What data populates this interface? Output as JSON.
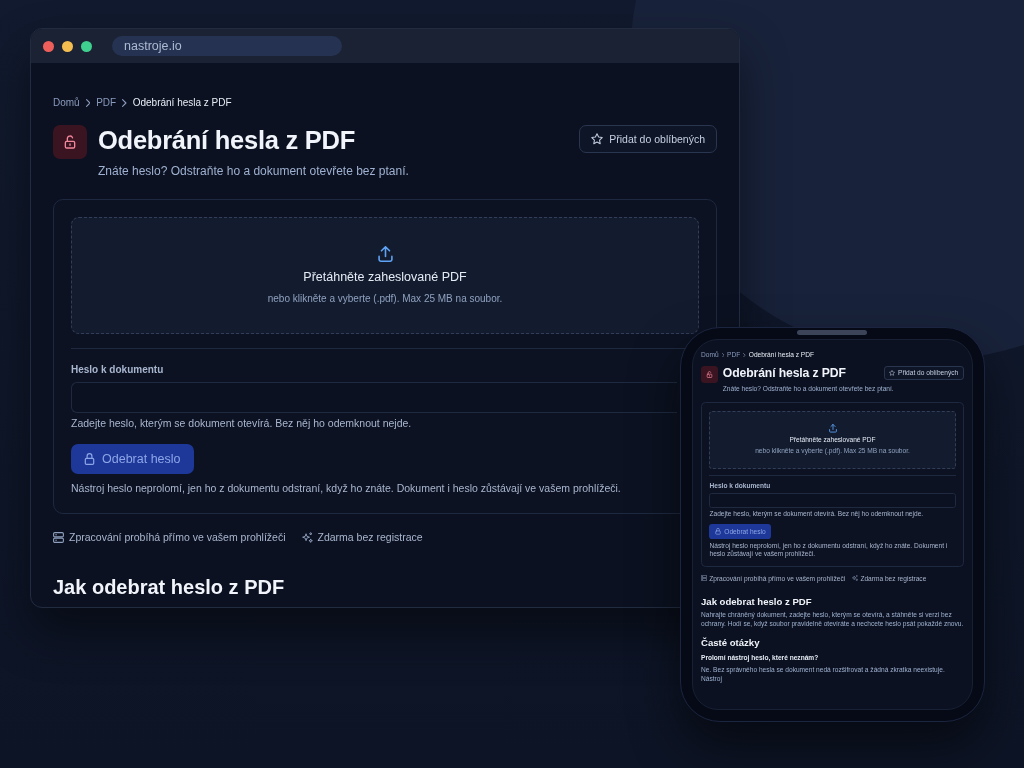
{
  "browser": {
    "address": "nastroje.io",
    "page": {
      "breadcrumb": [
        {
          "label": "Domů",
          "current": false
        },
        {
          "label": "PDF",
          "current": false
        },
        {
          "label": "Odebrání hesla z PDF",
          "current": true
        }
      ],
      "title": "Odebrání hesla z PDF",
      "subtitle": "Znáte heslo? Odstraňte ho a dokument otevřete bez ptaní.",
      "favorite_button": "Přidat do oblíbených",
      "dropzone": {
        "title": "Přetáhněte zaheslované PDF",
        "hint": "nebo klikněte a vyberte (.pdf). Max 25 MB na soubor."
      },
      "password": {
        "label": "Heslo k dokumentu",
        "help": "Zadejte heslo, kterým se dokument otevírá. Bez něj ho odemknout nejde."
      },
      "submit": {
        "label": "Odebrat heslo",
        "disabled": true
      },
      "note": "Nástroj heslo neprolomí, jen ho z dokumentu odstraní, když ho znáte. Dokument i heslo zůstávají ve vašem prohlížeči.",
      "features": [
        {
          "kind": "local",
          "label": "Zpracování probíhá přímo ve vašem prohlížeči"
        },
        {
          "kind": "free",
          "label": "Zdarma bez registrace"
        }
      ],
      "sections": [
        {
          "heading": "Jak odebrat heslo z PDF"
        }
      ]
    }
  },
  "phone": {
    "page": {
      "breadcrumb": [
        {
          "label": "Domů",
          "current": false
        },
        {
          "label": "PDF",
          "current": false
        },
        {
          "label": "Odebrání hesla z PDF",
          "current": true
        }
      ],
      "title": "Odebrání hesla z PDF",
      "subtitle": "Znáte heslo? Odstraňte ho a dokument otevřete bez ptaní.",
      "favorite_button": "Přidat do oblíbených",
      "dropzone": {
        "title": "Přetáhněte zaheslované PDF",
        "hint": "nebo klikněte a vyberte (.pdf). Max 25 MB na soubor."
      },
      "password": {
        "label": "Heslo k dokumentu",
        "help": "Zadejte heslo, kterým se dokument otevírá. Bez něj ho odemknout nejde."
      },
      "submit": {
        "label": "Odebrat heslo",
        "disabled": true
      },
      "note": "Nástroj heslo neprolomí, jen ho z dokumentu odstraní, když ho znáte. Dokument i heslo zůstávají ve vašem prohlížeči.",
      "features": [
        {
          "kind": "local",
          "label": "Zpracování probíhá přímo ve vašem prohlížeči"
        },
        {
          "kind": "free",
          "label": "Zdarma bez registrace"
        }
      ],
      "sections": [
        {
          "heading": "Jak odebrat heslo z PDF",
          "text": "Nahrajte chráněný dokument, zadejte heslo, kterým se otevírá, a stáhněte si verzi bez ochrany. Hodí se, když soubor pravidelně otevíráte a nechcete heslo psát pokaždé znovu."
        },
        {
          "heading": "Časté otázky",
          "faq": [
            {
              "question": "Prolomí nástroj heslo, které neznám?",
              "answer": "Ne. Bez správného hesla se dokument nedá rozšifrovat a žádná zkratka neexistuje. Nástroj"
            }
          ]
        }
      ]
    }
  }
}
